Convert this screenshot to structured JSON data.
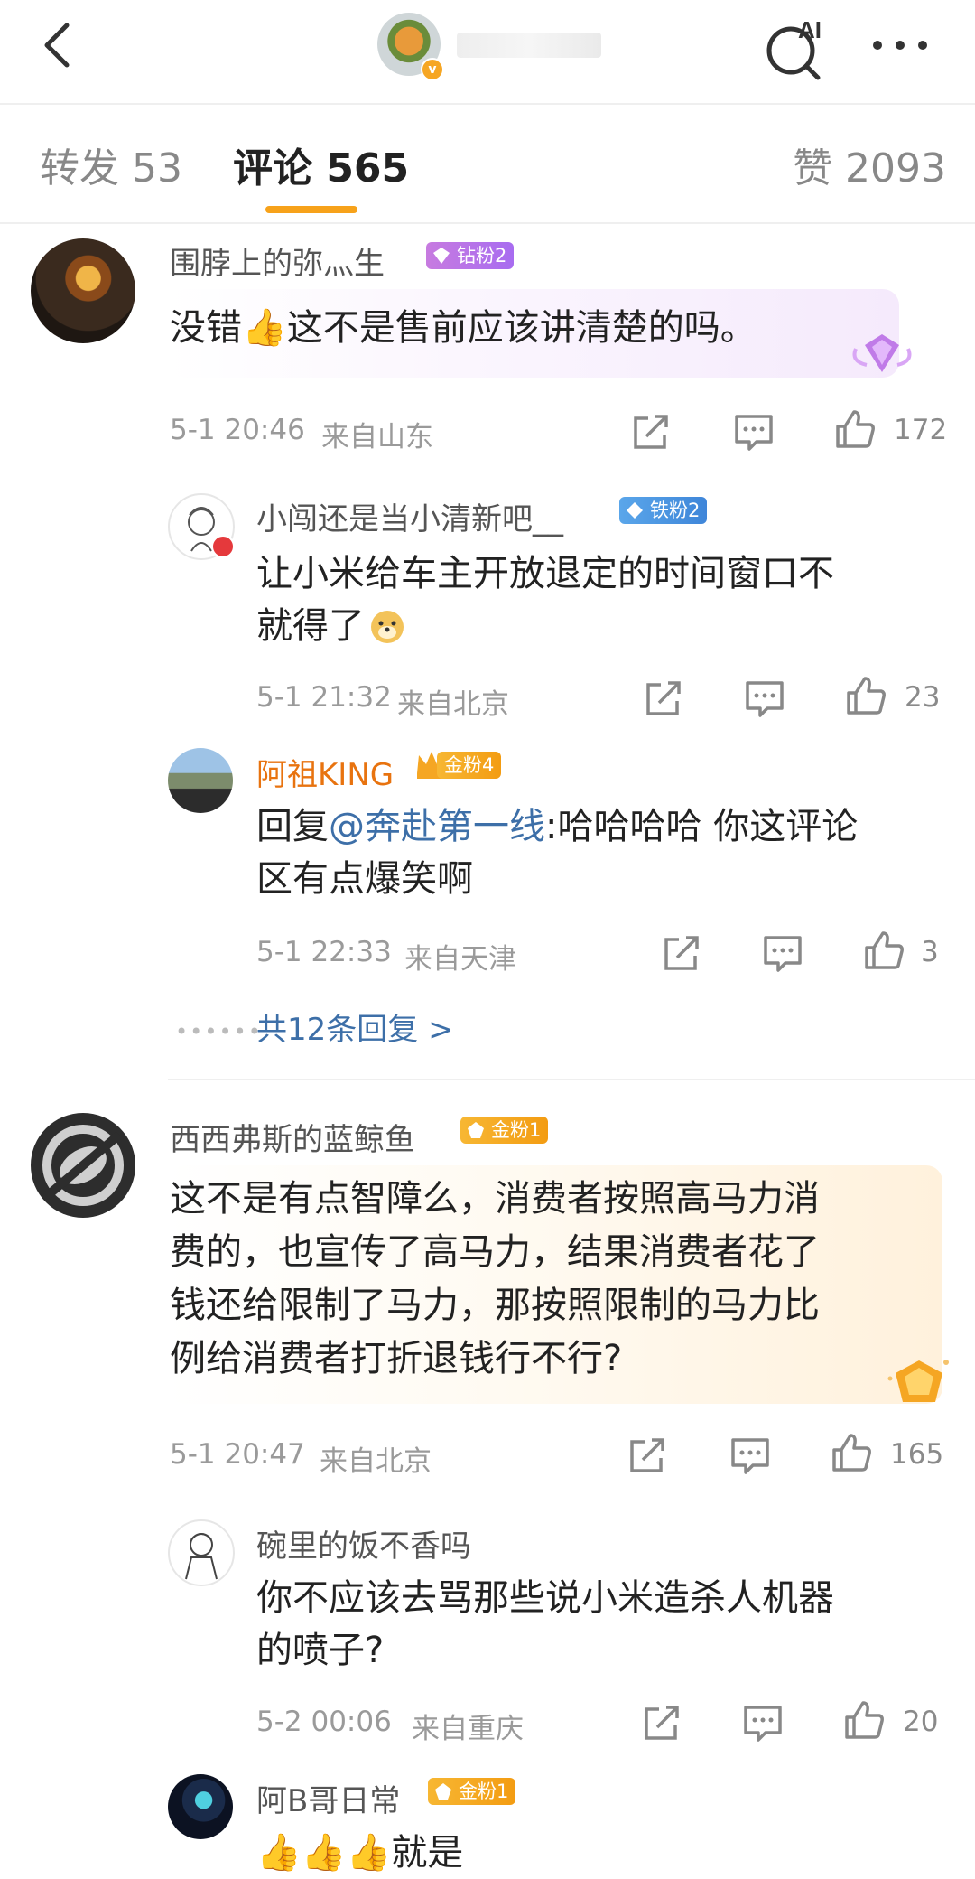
{
  "tabs": {
    "forward": "转发 53",
    "comments": "评论 565",
    "likes": "赞 2093"
  },
  "comments": [
    {
      "user": "围脖上的弥灬生",
      "badge": "钻粉2",
      "text": "没错👍这不是售前应该讲清楚的吗。",
      "time": "5-1 20:46",
      "location": "来自山东",
      "likes": "172",
      "replies": [
        {
          "user": "小闯还是当小清新吧__",
          "badge": "铁粉2",
          "text_line1": "让小米给车主开放退定的时间窗口不",
          "text_line2": "就得了",
          "time": "5-1 21:32",
          "location": "来自北京",
          "likes": "23"
        },
        {
          "user": "阿祖KING",
          "badge": "金粉4",
          "reply_prefix": "回复",
          "mention": "@奔赴第一线",
          "text_line1": ":哈哈哈哈 你这评论",
          "text_line2": "区有点爆笑啊",
          "time": "5-1 22:33",
          "location": "来自天津",
          "likes": "3"
        }
      ],
      "more_replies": "共12条回复 >"
    },
    {
      "user": "西西弗斯的蓝鲸鱼",
      "badge": "金粉1",
      "text_lines": [
        "这不是有点智障么，消费者按照高马力消",
        "费的，也宣传了高马力，结果消费者花了",
        "钱还给限制了马力，那按照限制的马力比",
        "例给消费者打折退钱行不行?"
      ],
      "time": "5-1 20:47",
      "location": "来自北京",
      "likes": "165",
      "replies": [
        {
          "user": "碗里的饭不香吗",
          "text_line1": "你不应该去骂那些说小米造杀人机器",
          "text_line2": "的喷子?",
          "time": "5-2 00:06",
          "location": "来自重庆",
          "likes": "20"
        },
        {
          "user": "阿B哥日常",
          "badge": "金粉1",
          "text_line1": "👍👍👍就是"
        }
      ]
    }
  ]
}
